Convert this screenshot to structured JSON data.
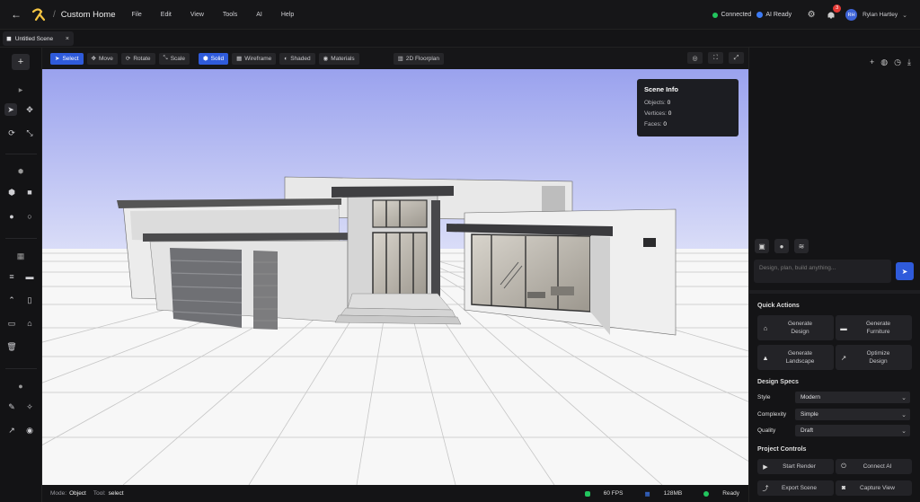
{
  "topbar": {
    "project_title": "Custom Home",
    "menu": [
      "File",
      "Edit",
      "View",
      "Tools",
      "AI",
      "Help"
    ],
    "connection_status": "Connected",
    "ai_status": "AI Ready",
    "notification_count": "3",
    "user_initials": "RH",
    "user_name": "Rylan Hartley"
  },
  "tabs": [
    {
      "label": "Untitled Scene"
    }
  ],
  "toolbar": {
    "transform_tools": [
      "Select",
      "Move",
      "Rotate",
      "Scale"
    ],
    "view_modes": [
      "Solid",
      "Wireframe",
      "Shaded",
      "Materials"
    ],
    "floorplan_label": "2D Floorplan"
  },
  "scene_info": {
    "title": "Scene Info",
    "objects_label": "Objects:",
    "objects_value": "0",
    "vertices_label": "Vertices:",
    "vertices_value": "0",
    "faces_label": "Faces:",
    "faces_value": "0"
  },
  "statusbar": {
    "mode_label": "Mode:",
    "mode_value": "Object",
    "tool_label": "Tool:",
    "tool_value": "select",
    "fps": "60 FPS",
    "memory": "128MB",
    "state": "Ready"
  },
  "chat": {
    "placeholder": "Design, plan, build anything..."
  },
  "quick_actions": {
    "title": "Quick Actions",
    "items": [
      {
        "line1": "Generate",
        "line2": "Design"
      },
      {
        "line1": "Generate",
        "line2": "Furniture"
      },
      {
        "line1": "Generate",
        "line2": "Landscape"
      },
      {
        "line1": "Optimize",
        "line2": "Design"
      }
    ]
  },
  "design_specs": {
    "title": "Design Specs",
    "style_label": "Style",
    "style_value": "Modern",
    "complexity_label": "Complexity",
    "complexity_value": "Simple",
    "quality_label": "Quality",
    "quality_value": "Draft"
  },
  "project_controls": {
    "title": "Project Controls",
    "start_render": "Start Render",
    "connect_ai": "Connect AI",
    "export_scene": "Export Scene",
    "capture_view": "Capture View"
  },
  "colors": {
    "accent": "#2f5bdb",
    "online": "#22c55e",
    "badge": "#e53935"
  }
}
